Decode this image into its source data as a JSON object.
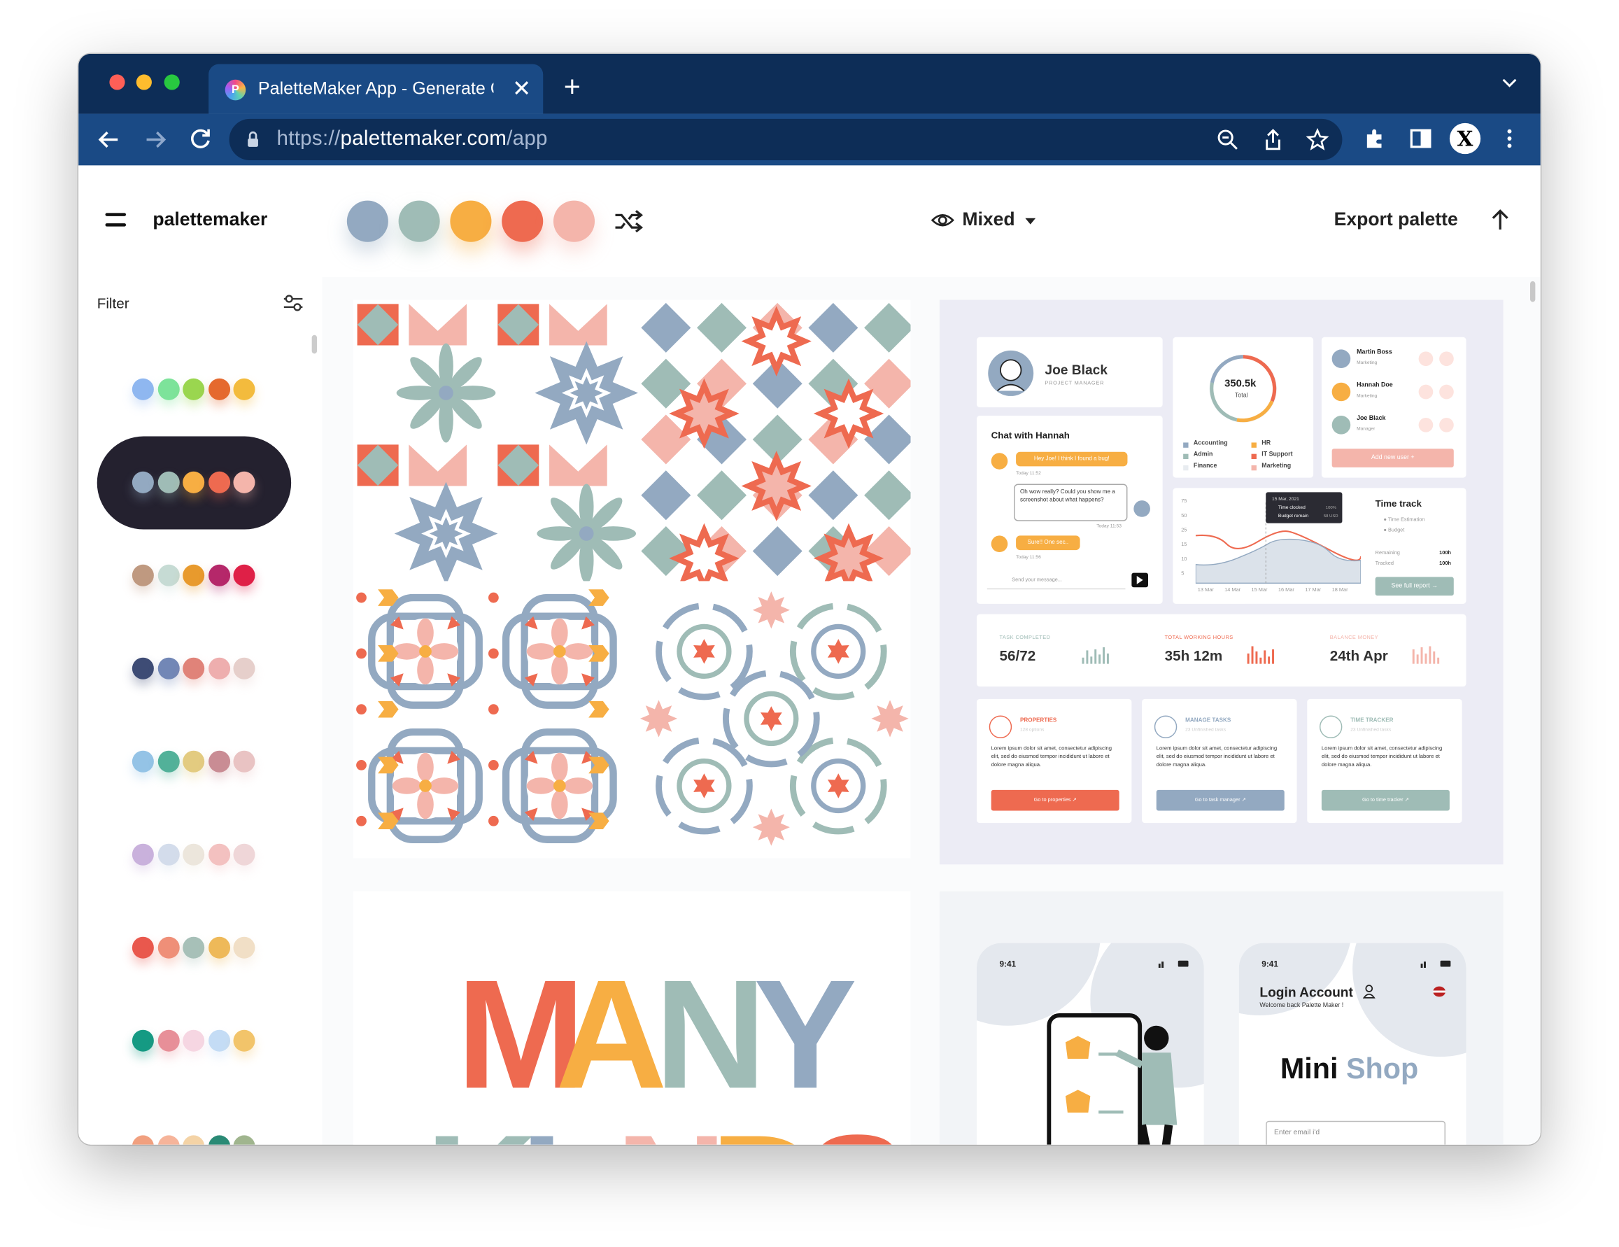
{
  "browser": {
    "tab_title": "PaletteMaker App - Generate Color",
    "url_scheme": "https://",
    "url_host": "palettemaker.com",
    "url_path": "/app",
    "profile_initial": "X"
  },
  "header": {
    "logo": "palettemaker",
    "palette": [
      "#93a9c1",
      "#9fbcb6",
      "#f7ae43",
      "#ee6a50",
      "#f4b5ab"
    ],
    "view_mode": "Mixed",
    "export_label": "Export palette"
  },
  "sidebar": {
    "filter_label": "Filter",
    "palettes": [
      {
        "colors": [
          "#8fb7f0",
          "#7de39a",
          "#9ad64f",
          "#e5692e",
          "#f3bb3d"
        ],
        "selected": false
      },
      {
        "colors": [
          "#93a9c1",
          "#9fbcb6",
          "#f7ae43",
          "#ee6a50",
          "#f4b5ab"
        ],
        "selected": true
      },
      {
        "colors": [
          "#bf9980",
          "#c6dbd4",
          "#e89a2d",
          "#b5286a",
          "#df2047"
        ],
        "selected": false
      },
      {
        "colors": [
          "#3e4c75",
          "#7287b6",
          "#e08379",
          "#eeaeae",
          "#e6cfcb"
        ],
        "selected": false
      },
      {
        "colors": [
          "#94c3e6",
          "#52b199",
          "#e3cb80",
          "#c98c94",
          "#e9c3c3"
        ],
        "selected": false
      },
      {
        "colors": [
          "#c9b1dc",
          "#d3dceb",
          "#ece6dc",
          "#f3c1c0",
          "#efd6d8"
        ],
        "selected": false
      },
      {
        "colors": [
          "#e9584d",
          "#ef8f78",
          "#a7c0b8",
          "#eeb959",
          "#f1dfc6"
        ],
        "selected": false
      },
      {
        "colors": [
          "#159a83",
          "#e78f98",
          "#f6d6e2",
          "#c4dcf5",
          "#f2c46a"
        ],
        "selected": false
      }
    ]
  },
  "dashboard": {
    "profile_name": "Joe Black",
    "profile_role": "PROJECT MANAGER",
    "donut_value": "350.5k",
    "donut_label": "Total",
    "legend": [
      "Accounting",
      "HR",
      "Admin",
      "IT Support",
      "Finance",
      "Marketing"
    ],
    "users": [
      {
        "name": "Martin Boss",
        "role": "Marketing"
      },
      {
        "name": "Hannah Doe",
        "role": "Marketing"
      },
      {
        "name": "Joe Black",
        "role": "Manager"
      }
    ],
    "add_user": "Add new user",
    "chat_title": "Chat with Hannah",
    "chat_msg1": "Hey Joe! I think I found a bug!",
    "chat_msg2": "Oh wow really? Could you show me a screenshot about what happens?",
    "chat_msg3": "Sure!! One sec..",
    "chat_time1": "Today 11:52",
    "chat_time2": "Today 11:53",
    "chat_time3": "Today 11:56",
    "chat_placeholder": "Send your message...",
    "time_track_title": "Time track",
    "time_estimation": "Time Estimation",
    "budget": "Budget",
    "remaining_label": "Remaining",
    "remaining_value": "100h",
    "tracked_label": "Tracked",
    "tracked_value": "100h",
    "full_report": "See full report",
    "tooltip_date": "15 Mar, 2021",
    "tooltip_a": "Time clocked",
    "tooltip_b": "Budget remain",
    "tooltip_a_val": "100%",
    "tooltip_b_val": "58 USD",
    "y_ticks": [
      "75",
      "50",
      "25",
      "15",
      "10",
      "5"
    ],
    "x_ticks": [
      "13 Mar",
      "14 Mar",
      "15 Mar",
      "16 Mar",
      "17 Mar",
      "18 Mar"
    ],
    "stats": [
      {
        "label": "TASK COMPLETED",
        "value": "56/72"
      },
      {
        "label": "TOTAL WORKING HOURS",
        "value": "35h 12m"
      },
      {
        "label": "BALANCE MONEY",
        "value": "24th Apr"
      }
    ],
    "features": [
      {
        "title": "PROPERTIES",
        "sub": "128 options",
        "btn": "Go to properties",
        "color": "#ee6a50"
      },
      {
        "title": "MANAGE TASKS",
        "sub": "23 Unfinished tasks",
        "btn": "Go to task manager",
        "color": "#93a9c1"
      },
      {
        "title": "TIME TRACKER",
        "sub": "23 Unfinished tasks",
        "btn": "Go to time tracker",
        "color": "#9fbcb6"
      }
    ],
    "lorem": "Lorem ipsum dolor sit amet, consectetur adipiscing elit, sed do eiusmod tempor incididunt ut labore et dolore magna aliqua."
  },
  "mobile": {
    "time": "9:41",
    "login_title": "Login Account",
    "login_sub": "Welcome back Palette Maker !",
    "shop_a": "Mini",
    "shop_b": "Shop",
    "email_placeholder": "Enter email i'd"
  },
  "lettering": "MANY KINDS"
}
